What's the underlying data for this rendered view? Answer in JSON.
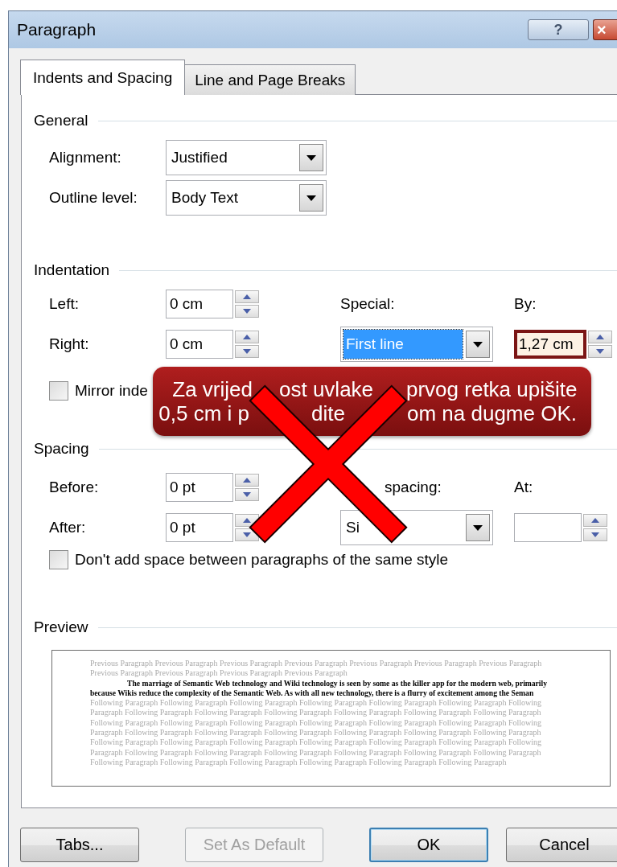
{
  "window": {
    "title": "Paragraph",
    "help_button": "?",
    "close_button": "×"
  },
  "tabs": [
    {
      "label": "Indents and Spacing",
      "selected": true
    },
    {
      "label": "Line and Page Breaks",
      "selected": false
    }
  ],
  "general": {
    "heading": "General",
    "fields": [
      {
        "label": "Alignment:",
        "value": "Justified"
      },
      {
        "label": "Outline level:",
        "value": "Body Text"
      }
    ]
  },
  "indentation": {
    "heading": "Indentation",
    "left": {
      "label": "Left:",
      "value": "0 cm"
    },
    "right": {
      "label": "Right:",
      "value": "0 cm"
    },
    "special": {
      "label": "Special:",
      "value": "First line",
      "highlighted": true
    },
    "by": {
      "label": "By:",
      "value": "1,27 cm",
      "highlighted": true
    },
    "mirror": {
      "label": "Mirror inde",
      "checked": false
    }
  },
  "spacing": {
    "heading": "Spacing",
    "before": {
      "label": "Before:",
      "value": "0 pt"
    },
    "after": {
      "label": "After:",
      "value": "0 pt"
    },
    "line_spacing": {
      "label": "spacing:",
      "value": "Si"
    },
    "at": {
      "label": "At:"
    },
    "dont_add": {
      "label": "Don't add space between paragraphs of the same style",
      "checked": false
    }
  },
  "preview": {
    "heading": "Preview",
    "previous": "Previous Paragraph Previous Paragraph Previous Paragraph Previous Paragraph Previous Paragraph Previous Paragraph Previous Paragraph Previous Paragraph Previous Paragraph Previous Paragraph Previous Paragraph",
    "sample": "The marriage of Semantic Web technology and Wiki technology is seen by some as the killer app for the modern web, primarily because Wikis reduce the complexity of the Semantic Web. As with all new technology, there is a flurry of excitement among the Seman",
    "following": "Following Paragraph Following Paragraph Following Paragraph Following Paragraph Following Paragraph Following Paragraph Following Paragraph Following Paragraph Following Paragraph Following Paragraph Following Paragraph Following Paragraph Following Paragraph Following Paragraph Following Paragraph Following Paragraph Following Paragraph Following Paragraph Following Paragraph Following Paragraph Following Paragraph Following Paragraph Following Paragraph Following Paragraph Following Paragraph Following Paragraph Following Paragraph Following Paragraph Following Paragraph Following Paragraph Following Paragraph Following Paragraph Following Paragraph Following Paragraph Following Paragraph Following Paragraph Following Paragraph Following Paragraph Following Paragraph Following Paragraph Following Paragraph Following Paragraph Following Paragraph Following Paragraph Following Paragraph"
  },
  "buttons": [
    {
      "label": "Tabs...",
      "disabled": false,
      "default": false
    },
    {
      "label": "Set As Default",
      "disabled": true,
      "default": false
    },
    {
      "label": "OK",
      "disabled": false,
      "default": true
    },
    {
      "label": "Cancel",
      "disabled": false,
      "default": false
    }
  ],
  "callout": {
    "lines": [
      [
        "Za vrijed",
        "ost uvlake",
        "prvog retka upišite"
      ],
      [
        "0,5 cm i p",
        "dite",
        "om na dugme OK."
      ]
    ]
  }
}
